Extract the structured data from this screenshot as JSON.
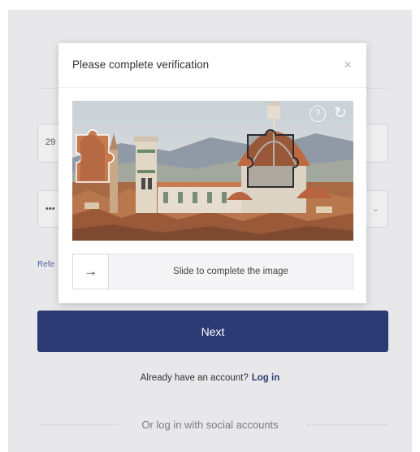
{
  "background": {
    "field_1_value": "29",
    "field_2_value": "•••",
    "link_text": "Refe",
    "next_label": "Next",
    "account_prompt": "Already have an account?",
    "login_label": "Log in",
    "social_text": "Or log in with social accounts"
  },
  "modal": {
    "title": "Please complete verification",
    "close_icon": "×",
    "help_icon": "?",
    "refresh_icon": "↻",
    "slider_arrow": "→",
    "slider_text": "Slide to complete the image"
  },
  "colors": {
    "primary": "#2b3a73",
    "overlay": "#e8e8ea"
  },
  "icons": [
    "close-icon",
    "help-icon",
    "refresh-icon",
    "arrow-right-icon",
    "chevron-down-icon"
  ]
}
